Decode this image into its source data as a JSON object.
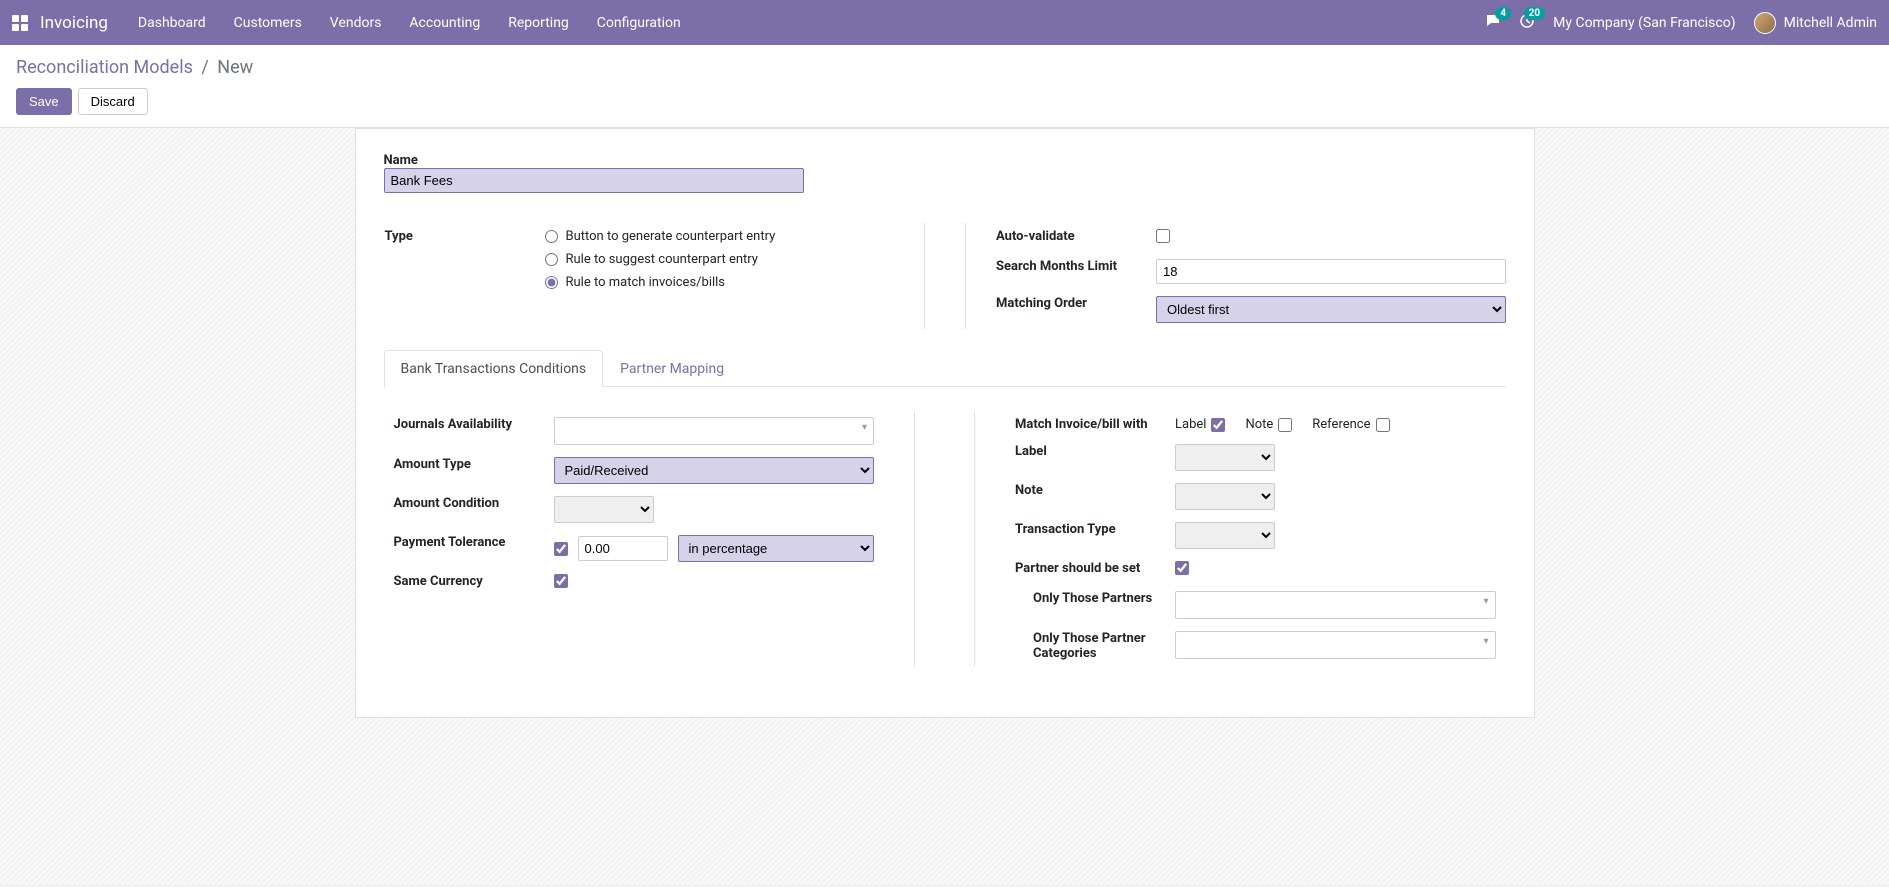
{
  "nav": {
    "app": "Invoicing",
    "menu": [
      "Dashboard",
      "Customers",
      "Vendors",
      "Accounting",
      "Reporting",
      "Configuration"
    ],
    "msg_count": "4",
    "activity_count": "20",
    "company": "My Company (San Francisco)",
    "user": "Mitchell Admin"
  },
  "breadcrumb": {
    "parent": "Reconciliation Models",
    "current": "New"
  },
  "cp": {
    "save": "Save",
    "discard": "Discard"
  },
  "form": {
    "name_label": "Name",
    "name_value": "Bank Fees",
    "type_label": "Type",
    "type_options": [
      "Button to generate counterpart entry",
      "Rule to suggest counterpart entry",
      "Rule to match invoices/bills"
    ],
    "type_selected": 2,
    "auto_validate_label": "Auto-validate",
    "auto_validate": false,
    "months_limit_label": "Search Months Limit",
    "months_limit_value": "18",
    "matching_order_label": "Matching Order",
    "matching_order_value": "Oldest first"
  },
  "tabs": [
    "Bank Transactions Conditions",
    "Partner Mapping"
  ],
  "tab_active": 0,
  "btc": {
    "journals_label": "Journals Availability",
    "amount_type_label": "Amount Type",
    "amount_type_value": "Paid/Received",
    "amount_cond_label": "Amount Condition",
    "amount_cond_value": "",
    "pay_tol_label": "Payment Tolerance",
    "pay_tol_checked": true,
    "pay_tol_amount": "0.00",
    "pay_tol_unit": "in percentage",
    "same_curr_label": "Same Currency",
    "same_curr_checked": true,
    "match_with_label": "Match Invoice/bill with",
    "match_label": "Label",
    "match_note": "Note",
    "match_ref": "Reference",
    "match_label_checked": true,
    "match_note_checked": false,
    "match_ref_checked": false,
    "label_label": "Label",
    "label_value": "",
    "note_label": "Note",
    "note_value": "",
    "tx_type_label": "Transaction Type",
    "tx_type_value": "",
    "partner_set_label": "Partner should be set",
    "partner_set_checked": true,
    "only_partners_label": "Only Those Partners",
    "only_cats_label": "Only Those Partner Categories"
  }
}
